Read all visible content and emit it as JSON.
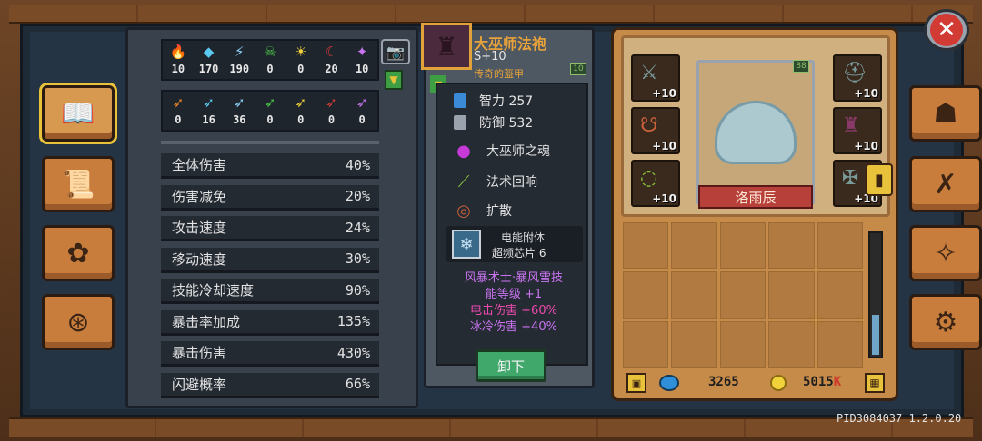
{
  "resources_row1": [
    {
      "icon": "fire-icon",
      "glyph": "🔥",
      "color": "#f08a2a",
      "value": "10"
    },
    {
      "icon": "ice-crystal-icon",
      "glyph": "◆",
      "color": "#5ac8f0",
      "value": "170"
    },
    {
      "icon": "lightning-icon",
      "glyph": "⚡",
      "color": "#8ad0f8",
      "value": "190"
    },
    {
      "icon": "poison-skull-icon",
      "glyph": "☠",
      "color": "#4ac84a",
      "value": "0"
    },
    {
      "icon": "sun-icon",
      "glyph": "☀",
      "color": "#f2d23a",
      "value": "0"
    },
    {
      "icon": "crescent-icon",
      "glyph": "☾",
      "color": "#d23a3a",
      "value": "20"
    },
    {
      "icon": "purple-gem-icon",
      "glyph": "✦",
      "color": "#c874f0",
      "value": "10"
    }
  ],
  "resources_row2": [
    {
      "icon": "fire-arrow-icon",
      "glyph": "➶",
      "color": "#f08a2a",
      "value": "0"
    },
    {
      "icon": "ice-arrow-icon",
      "glyph": "➶",
      "color": "#5ac8f0",
      "value": "16"
    },
    {
      "icon": "lightning-arrow-icon",
      "glyph": "➶",
      "color": "#8ad0f8",
      "value": "36"
    },
    {
      "icon": "poison-arrow-icon",
      "glyph": "➶",
      "color": "#4ac84a",
      "value": "0"
    },
    {
      "icon": "sun-arrow-icon",
      "glyph": "➶",
      "color": "#f2d23a",
      "value": "0"
    },
    {
      "icon": "blood-arrow-icon",
      "glyph": "➶",
      "color": "#d23a3a",
      "value": "0"
    },
    {
      "icon": "arcane-arrow-icon",
      "glyph": "➶",
      "color": "#c874f0",
      "value": "0"
    }
  ],
  "stats": [
    {
      "label": "全体伤害",
      "value": "40%"
    },
    {
      "label": "伤害减免",
      "value": "20%"
    },
    {
      "label": "攻击速度",
      "value": "24%"
    },
    {
      "label": "移动速度",
      "value": "30%"
    },
    {
      "label": "技能冷却速度",
      "value": "90%"
    },
    {
      "label": "暴击率加成",
      "value": "135%"
    },
    {
      "label": "暴击伤害",
      "value": "430%"
    },
    {
      "label": "闪避概率",
      "value": "66%"
    }
  ],
  "item": {
    "name": "大巫师法袍",
    "level": "S+10",
    "type": "传奇的盔甲",
    "badge": "10",
    "attributes": [
      {
        "label": "智力 257",
        "color": "#3a8ad8"
      },
      {
        "label": "防御 532",
        "color": "#9aa3ad"
      }
    ],
    "skills": [
      {
        "label": "大巫师之魂",
        "icon": "purple-flame-icon",
        "glyph": "●",
        "color": "#c83ad8"
      },
      {
        "label": "法术回响",
        "icon": "staff-icon",
        "glyph": "⟋",
        "color": "#8ac83a"
      },
      {
        "label": "扩散",
        "icon": "ring-spread-icon",
        "glyph": "◎",
        "color": "#c8603a"
      }
    ],
    "chip_line1": "电能附体",
    "chip_line2": "超频芯片 6",
    "set_effect_line1": "风暴术士·暴风雪技",
    "set_effect_line2": "能等级 +1",
    "effect_lightning": "电击伤害 +60%",
    "effect_cold": "冰冷伤害 +40%",
    "colors": {
      "purple": "#c874f0",
      "pink": "#f04ab0"
    },
    "unequip_label": "卸下"
  },
  "character": {
    "name": "洛雨辰",
    "badge": "88"
  },
  "equip_slots": [
    {
      "name": "weapon-slot",
      "glyph": "⚔",
      "plus": "+10"
    },
    {
      "name": "helmet-slot",
      "glyph": "⛑",
      "plus": "+10"
    },
    {
      "name": "amulet-slot",
      "glyph": "☋",
      "plus": "+10"
    },
    {
      "name": "armor-slot",
      "glyph": "♜",
      "plus": "+10"
    },
    {
      "name": "ring-slot",
      "glyph": "◌",
      "plus": "+10"
    },
    {
      "name": "offhand-slot",
      "glyph": "✠",
      "plus": "+10"
    }
  ],
  "currency": {
    "gems": "3265",
    "gold": "5015",
    "gold_suffix": "K"
  },
  "version": "PID3084037 1.2.0.20"
}
